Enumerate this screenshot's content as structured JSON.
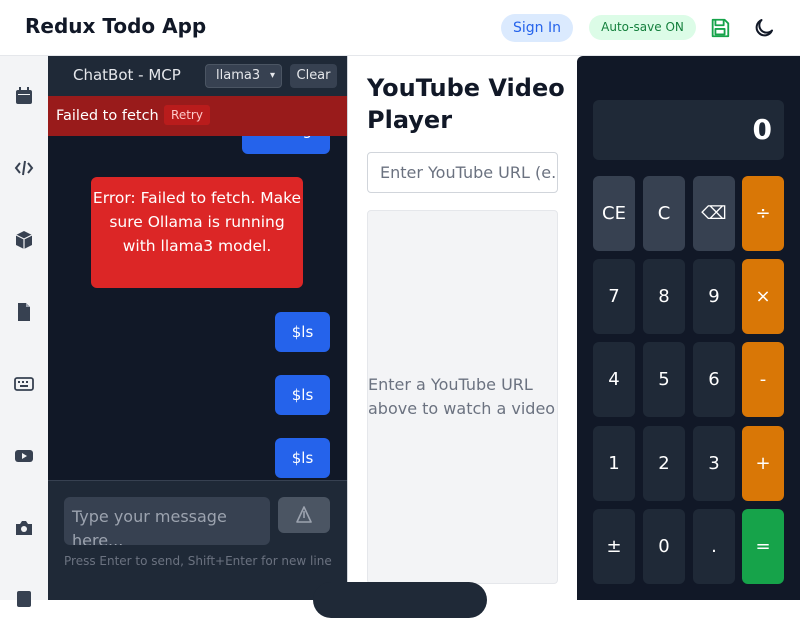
{
  "header": {
    "title": "Redux Todo App",
    "sign_in": "Sign In",
    "autosave": "Auto-save ON"
  },
  "sidebar": {
    "icons": [
      "calendar-icon",
      "code-icon",
      "cube-icon",
      "document-icon",
      "keyboard-icon",
      "youtube-icon",
      "camera-icon",
      "list-icon"
    ]
  },
  "chat": {
    "title": "ChatBot - MCP",
    "model": "llama3",
    "clear_label": "Clear",
    "error_banner": "Failed to fetch",
    "retry_label": "Retry",
    "messages": [
      {
        "role": "user",
        "text": "testing"
      },
      {
        "role": "error",
        "text": "Error: Failed to fetch. Make sure Ollama is running with llama3 model."
      },
      {
        "role": "user",
        "text": "$ls"
      },
      {
        "role": "user",
        "text": "$ls"
      },
      {
        "role": "user",
        "text": "$ls"
      }
    ],
    "input_placeholder": "Type your message here...",
    "hint": "Press Enter to send, Shift+Enter for new line"
  },
  "youtube": {
    "title": "YouTube Video Player",
    "url_placeholder": "Enter YouTube URL (e.g.",
    "empty_text": "Enter a YouTube URL above to watch a video"
  },
  "calculator": {
    "display": "0",
    "keys": [
      "CE",
      "C",
      "⌫",
      "÷",
      "7",
      "8",
      "9",
      "×",
      "4",
      "5",
      "6",
      "-",
      "1",
      "2",
      "3",
      "+",
      "±",
      "0",
      ".",
      "="
    ]
  },
  "colors": {
    "accent": "#2563eb",
    "error": "#dc2626",
    "operator": "#d97706",
    "equals": "#16a34a"
  }
}
